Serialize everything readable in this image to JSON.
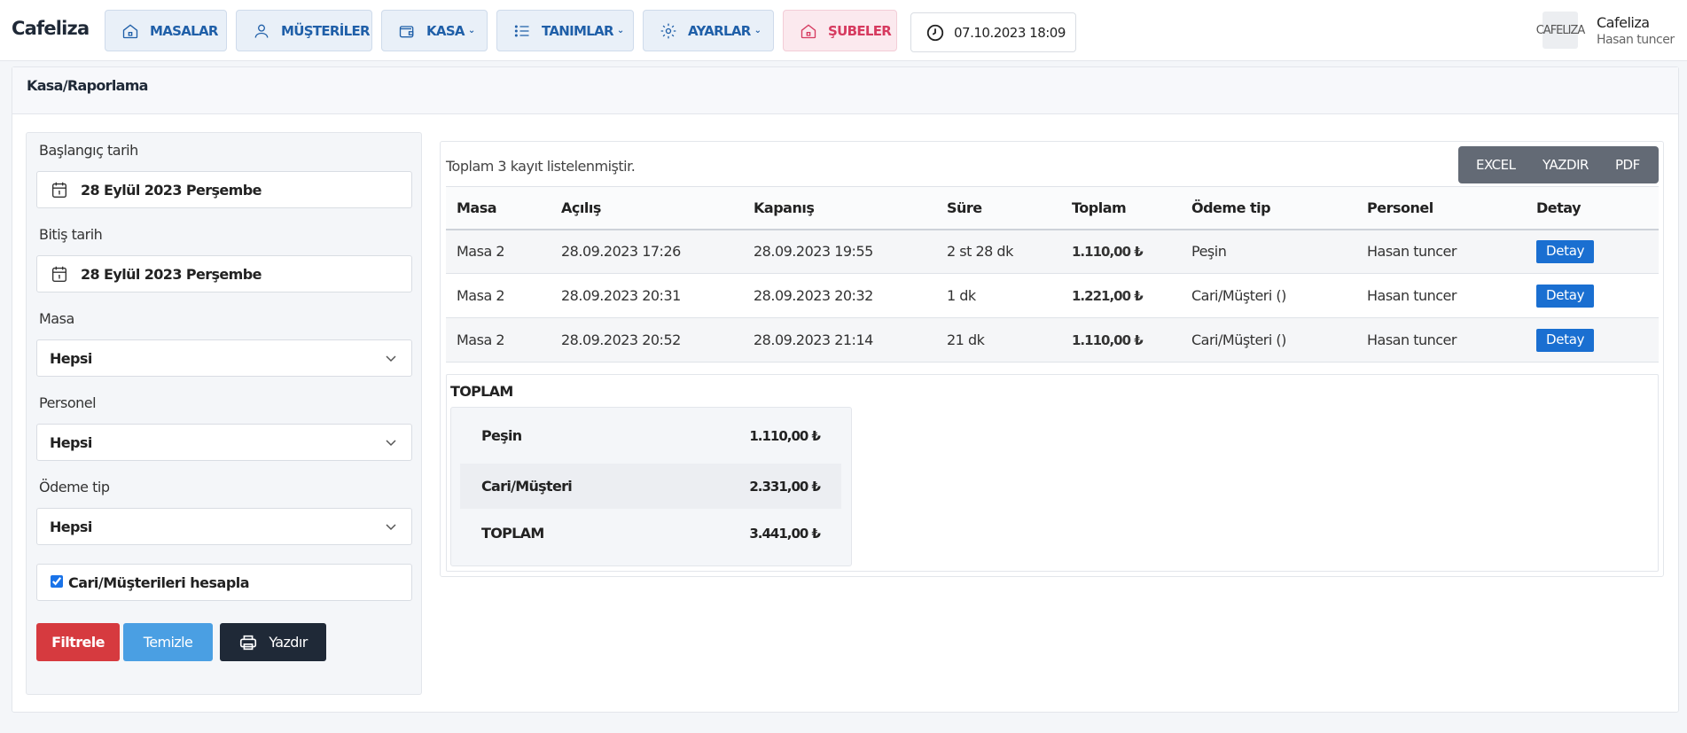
{
  "app": {
    "brand": "Cafeliza",
    "nav": [
      {
        "label": "MASALAR",
        "icon": "home-icon"
      },
      {
        "label": "MÜŞTERİLER",
        "icon": "user-icon"
      },
      {
        "label": "KASA",
        "icon": "wallet-icon"
      },
      {
        "label": "TANIMLAR",
        "icon": "list-icon"
      },
      {
        "label": "AYARLAR",
        "icon": "gear-icon"
      },
      {
        "label": "ŞUBELER",
        "icon": "home-icon"
      }
    ],
    "datetime": "07.10.2023 18:09",
    "user": {
      "avatar_text": "CAFELIZA",
      "name": "Cafeliza",
      "subtitle": "Hasan tuncer"
    }
  },
  "page": {
    "title": "Kasa/Raporlama"
  },
  "filters": {
    "start_label": "Başlangıç tarih",
    "start_value": "28 Eylül 2023 Perşembe",
    "end_label": "Bitiş tarih",
    "end_value": "28 Eylül 2023 Perşembe",
    "masa_label": "Masa",
    "masa_value": "Hepsi",
    "personel_label": "Personel",
    "personel_value": "Hepsi",
    "odeme_label": "Ödeme tip",
    "odeme_value": "Hepsi",
    "checkbox_label": "Cari/Müşterileri hesapla",
    "checkbox_checked": true,
    "btn_filter": "Filtrele",
    "btn_clear": "Temizle",
    "btn_print": "Yazdır"
  },
  "results": {
    "count_text": "Toplam 3 kayıt listelenmiştir.",
    "export": {
      "excel": "EXCEL",
      "print": "YAZDIR",
      "pdf": "PDF"
    },
    "columns": [
      "Masa",
      "Açılış",
      "Kapanış",
      "Süre",
      "Toplam",
      "Ödeme tip",
      "Personel",
      "Detay"
    ],
    "rows": [
      {
        "masa": "Masa 2",
        "acilis": "28.09.2023 17:26",
        "kapanis": "28.09.2023 19:55",
        "sure": "2 st 28 dk",
        "toplam": "1.110,00 ₺",
        "odeme": "Peşin",
        "personel": "Hasan tuncer",
        "detay": "Detay"
      },
      {
        "masa": "Masa 2",
        "acilis": "28.09.2023 20:31",
        "kapanis": "28.09.2023 20:32",
        "sure": "1 dk",
        "toplam": "1.221,00 ₺",
        "odeme": "Cari/Müşteri ()",
        "personel": "Hasan tuncer",
        "detay": "Detay"
      },
      {
        "masa": "Masa 2",
        "acilis": "28.09.2023 20:52",
        "kapanis": "28.09.2023 21:14",
        "sure": "21 dk",
        "toplam": "1.110,00 ₺",
        "odeme": "Cari/Müşteri ()",
        "personel": "Hasan tuncer",
        "detay": "Detay"
      }
    ],
    "summary": {
      "title": "TOPLAM",
      "rows": [
        {
          "label": "Peşin",
          "value": "1.110,00 ₺"
        },
        {
          "label": "Cari/Müşteri",
          "value": "2.331,00 ₺"
        },
        {
          "label": "TOPLAM",
          "value": "3.441,00 ₺"
        }
      ]
    }
  },
  "colors": {
    "nav_text": "#1f5fa8",
    "nav_pink": "#d63a5f",
    "filter_red": "#d63a3f",
    "clear_blue": "#4a9fe3",
    "print_dark": "#1f2937",
    "detay_blue": "#1a6fd1",
    "export_gray": "#636a75"
  }
}
